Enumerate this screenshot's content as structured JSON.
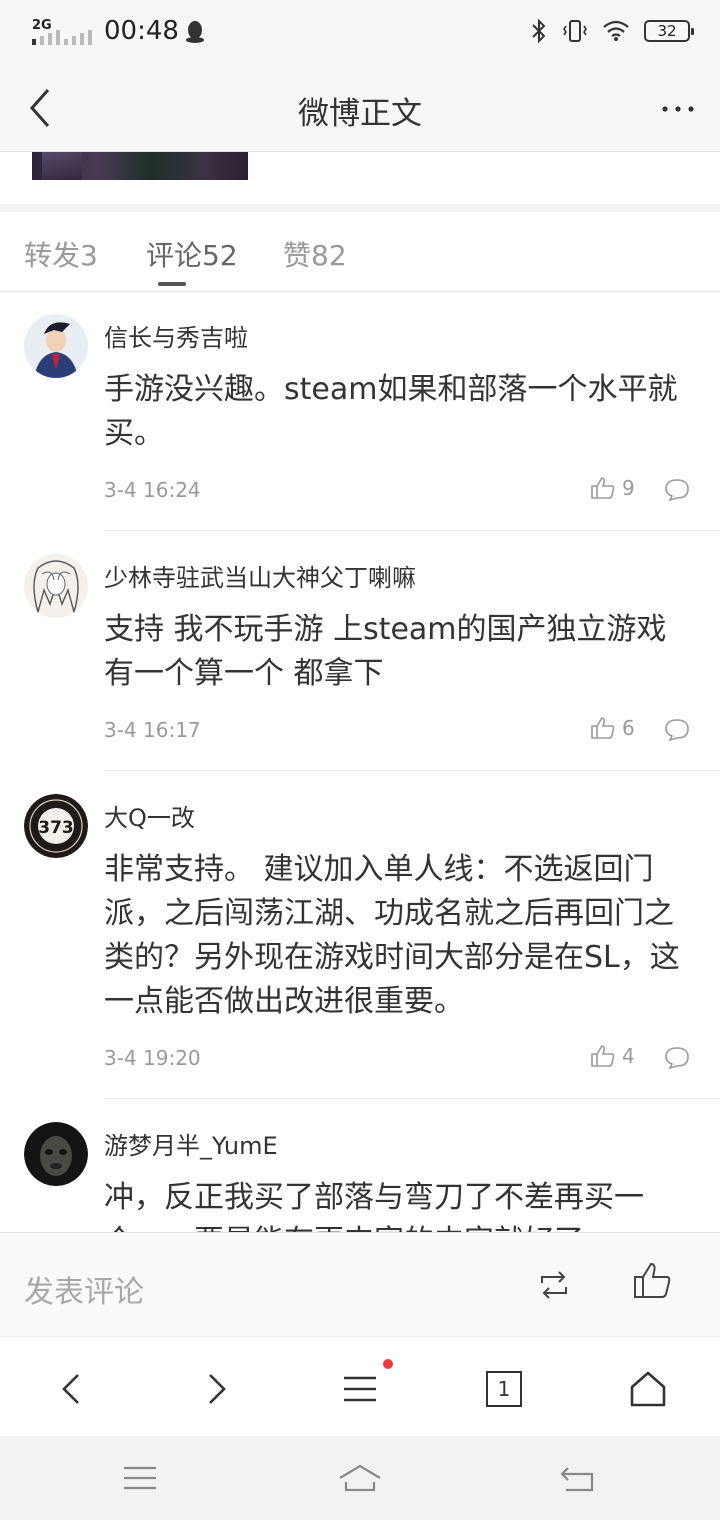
{
  "status_bar": {
    "network": "2G",
    "time": "00:48",
    "battery": "32"
  },
  "nav": {
    "title": "微博正文"
  },
  "tabs": [
    {
      "label": "转发3"
    },
    {
      "label": "评论52"
    },
    {
      "label": "赞82"
    }
  ],
  "active_tab": "评论52",
  "comments": [
    {
      "name": "信长与秀吉啦",
      "text": "手游没兴趣。steam如果和部落一个水平就买。",
      "time": "3-4 16:24",
      "likes": "9"
    },
    {
      "name": "少林寺驻武当山大神父丁喇嘛",
      "text": "支持 我不玩手游 上steam的国产独立游戏有一个算一个 都拿下",
      "time": "3-4 16:17",
      "likes": "6"
    },
    {
      "name": "大Q一改",
      "text": "非常支持。 建议加入单人线：不选返回门派，之后闯荡江湖、功成名就之后再回门之类的？另外现在游戏时间大部分是在SL，这一点能否做出改进很重要。",
      "time": "3-4 19:20",
      "likes": "4"
    },
    {
      "name": "游梦月半_YumE",
      "text": "冲，反正我买了部落与弯刀了不差再买一个……要是能有更丰富的内容就好了",
      "time": "",
      "likes": ""
    }
  ],
  "compose": {
    "placeholder": "发表评论"
  },
  "browser": {
    "tab_count": "1"
  },
  "colors": {
    "notification_dot": "#ef3a3a",
    "text_primary": "#333333",
    "text_secondary": "#9a9a9a"
  }
}
